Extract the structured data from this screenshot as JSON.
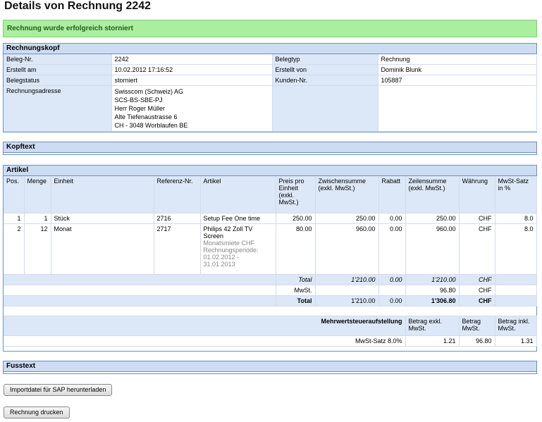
{
  "page": {
    "title": "Details von Rechnung 2242"
  },
  "alert": {
    "message": "Rechnung wurde erfolgreich storniert"
  },
  "header": {
    "title": "Rechnungskopf",
    "left": [
      {
        "label": "Beleg-Nr.",
        "value": "2242"
      },
      {
        "label": "Erstellt am",
        "value": "10.02.2012 17:16:52"
      },
      {
        "label": "Belegstatus",
        "value": "storniert"
      }
    ],
    "right": [
      {
        "label": "Belegtyp",
        "value": "Rechnung"
      },
      {
        "label": "Erstellt von",
        "value": "Dominik Blunk"
      },
      {
        "label": "Kunden-Nr.",
        "value": "105887"
      }
    ],
    "address_label": "Rechnungsadresse",
    "address": [
      "Swisscom (Schweiz) AG",
      "SCS-BS-SBE-PJ",
      "Herr Roger Müller",
      "Alte Tiefenaustrasse 6",
      "CH - 3048 Worblaufen BE"
    ]
  },
  "kopftext": {
    "title": "Kopftext"
  },
  "articles": {
    "title": "Artikel",
    "columns": {
      "pos": "Pos.",
      "menge": "Menge",
      "einheit": "Einheit",
      "ref": "Referenz-Nr.",
      "artikel": "Artikel",
      "preis": "Preis pro Einheit (exkl. MwSt.)",
      "zwischen": "Zwischensumme (exkl. MwSt.)",
      "rabatt": "Rabatt",
      "zeilen": "Zeilensumme (exkl. MwSt.)",
      "waehrung": "Währung",
      "mwst": "MwSt-Satz in %"
    },
    "rows": [
      {
        "pos": "1",
        "menge": "1",
        "einheit": "Stück",
        "ref": "2716",
        "artikel": "Setup Fee One time",
        "note": "",
        "preis": "250.00",
        "zwischen": "250.00",
        "rabatt": "0.00",
        "zeilen": "250.00",
        "waehrung": "CHF",
        "mwst": "8.0"
      },
      {
        "pos": "2",
        "menge": "12",
        "einheit": "Monat",
        "ref": "2717",
        "artikel": "Philips 42 Zoll TV Screen",
        "note": "Monatsmiete CHF Rechnungsperiode: 01.02.2012 - 31.01.2013",
        "preis": "80.00",
        "zwischen": "960.00",
        "rabatt": "0.00",
        "zeilen": "960.00",
        "waehrung": "CHF",
        "mwst": "8.0"
      }
    ],
    "total_row": {
      "label": "Total",
      "zwischen": "1'210.00",
      "rabatt": "0.00",
      "zeilen": "1'210.00",
      "waehrung": "CHF"
    },
    "mwst_row": {
      "label": "MwSt.",
      "zeilen": "96.80",
      "waehrung": "CHF"
    },
    "grand_total": {
      "label": "Total",
      "zwischen": "1'210.00",
      "rabatt": "0.00",
      "zeilen": "1'306.80",
      "waehrung": "CHF"
    },
    "vat_summary": {
      "title": "Mehrwertsteueraufstellung",
      "col1": "Betrag exkl. MwSt.",
      "col2": "Betrag MwSt.",
      "col3": "Betrag inkl. MwSt.",
      "rate_label": "MwSt-Satz 8.0%",
      "exkl": "1.21",
      "mwst": "96.80",
      "inkl": "1.31"
    }
  },
  "fusstext": {
    "title": "Fusstext"
  },
  "buttons": {
    "sap": "Importdatei für SAP herunterladen",
    "print": "Rechnung drucken"
  }
}
